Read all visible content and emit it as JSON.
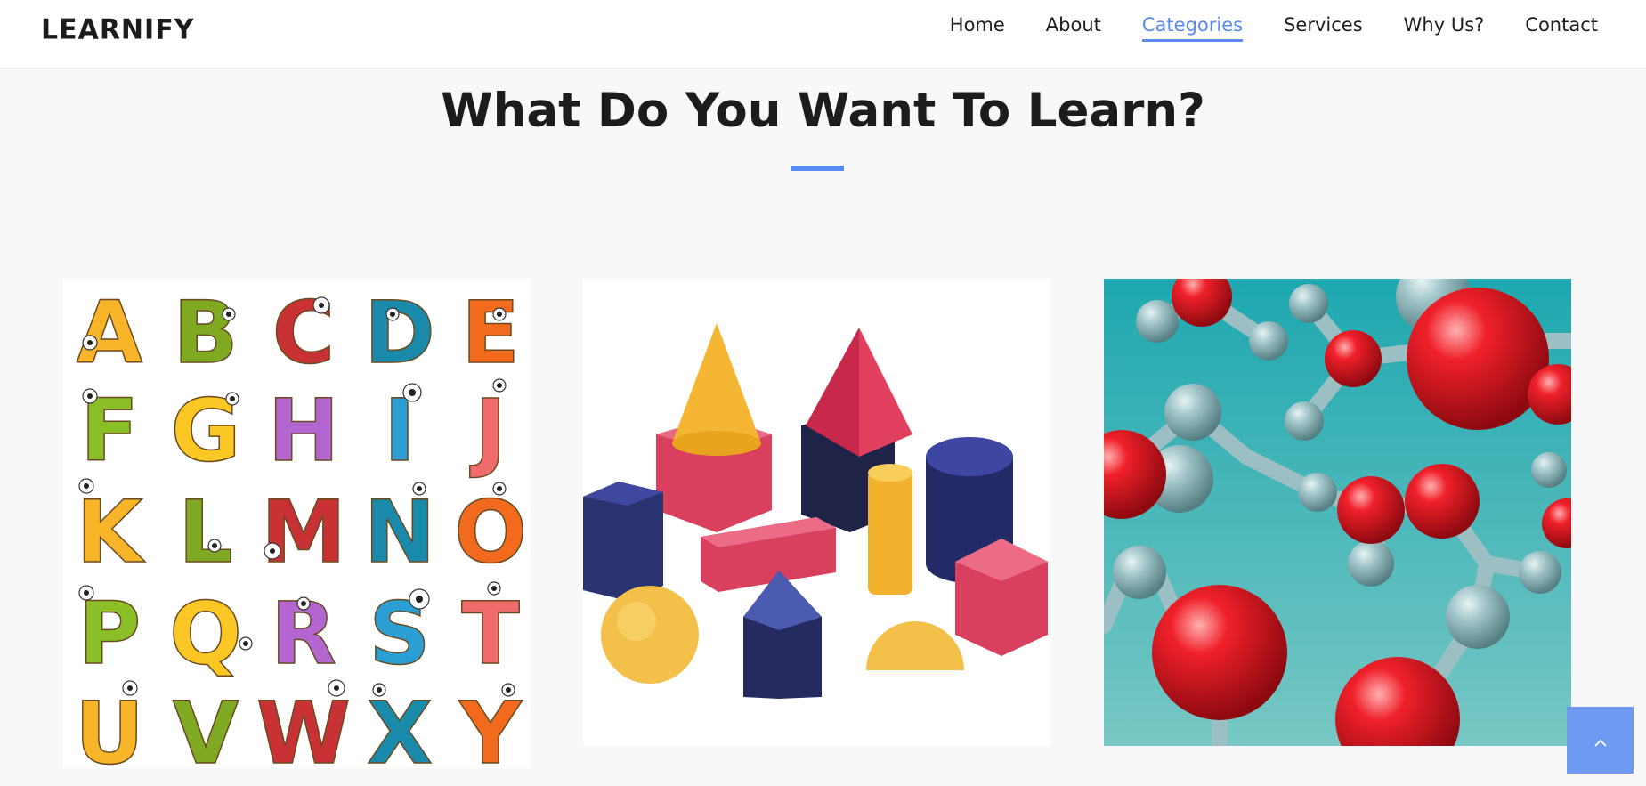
{
  "brand": {
    "logo_text": "LEARNIFY"
  },
  "nav": {
    "items": [
      {
        "label": "Home"
      },
      {
        "label": "About"
      },
      {
        "label": "Categories",
        "active": true
      },
      {
        "label": "Services"
      },
      {
        "label": "Why Us?"
      },
      {
        "label": "Contact"
      }
    ]
  },
  "section": {
    "title": "What Do You Want To Learn?"
  },
  "categories": [
    {
      "image": "alphabet-letters-image"
    },
    {
      "image": "geometric-shapes-image"
    },
    {
      "image": "molecule-model-image"
    }
  ],
  "back_to_top": {
    "icon": "chevron-up-icon"
  },
  "colors": {
    "accent": "#5b8bf0",
    "back_to_top_bg": "#6e9af2",
    "page_bg": "#f8f8f8",
    "header_bg": "#ffffff"
  }
}
